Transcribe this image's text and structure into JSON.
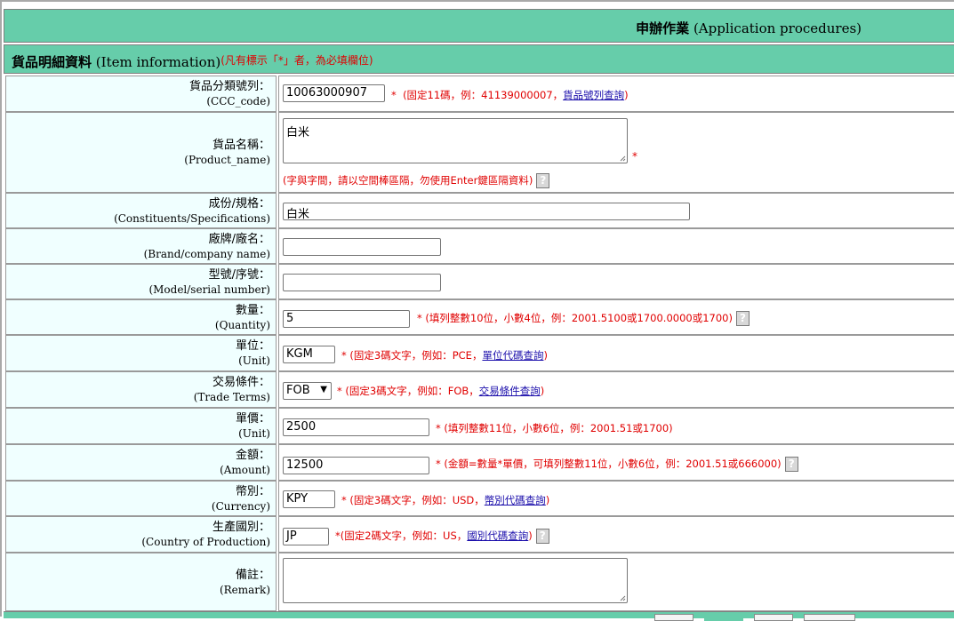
{
  "header": {
    "title_zh": "申辦作業",
    "title_en": "(Application procedures)"
  },
  "section": {
    "title_zh": "貨品明細資料",
    "title_en": "(Item information)",
    "required_note": "(凡有標示「*」者，為必填欄位)"
  },
  "fields": {
    "ccc": {
      "label_zh": "貨品分類號列：",
      "label_en": "(CCC_code)",
      "value": "10063000907",
      "star": "*",
      "note": "(固定11碼，例：41139000007，",
      "link": "貨品號列查詢",
      "note_end": ")"
    },
    "product": {
      "label_zh": "貨品名稱：",
      "label_en": "(Product_name)",
      "value": "白米",
      "star": "*",
      "note": "(字與字間，請以空間棒區隔，勿使用Enter鍵區隔資料)",
      "help": "?"
    },
    "spec": {
      "label_zh": "成份/規格：",
      "label_en": "(Constituents/Specifications)",
      "value": "白米"
    },
    "brand": {
      "label_zh": "廠牌/廠名：",
      "label_en": "(Brand/company name)",
      "value": ""
    },
    "model": {
      "label_zh": "型號/序號：",
      "label_en": "(Model/serial number)",
      "value": ""
    },
    "quantity": {
      "label_zh": "數量：",
      "label_en": "(Quantity)",
      "value": "5",
      "note": "* (填列整數10位，小數4位，例：2001.5100或1700.0000或1700)",
      "help": "?"
    },
    "unit": {
      "label_zh": "單位：",
      "label_en": "(Unit)",
      "value": "KGM",
      "note": "* (固定3碼文字，例如：PCE，",
      "link": "單位代碼查詢",
      "note_end": ")"
    },
    "trade": {
      "label_zh": "交易條件：",
      "label_en": "(Trade Terms)",
      "value": "FOB",
      "note": "* (固定3碼文字，例如：FOB，",
      "link": "交易條件查詢",
      "note_end": ")"
    },
    "price": {
      "label_zh": "單價：",
      "label_en": "(Unit)",
      "value": "2500",
      "note": "* (填列整數11位，小數6位，例：2001.51或1700)"
    },
    "amount": {
      "label_zh": "金額：",
      "label_en": "(Amount)",
      "value": "12500",
      "note": "* (金額=數量*單價，可填列整數11位，小數6位，例：2001.51或666000)",
      "help": "?"
    },
    "currency": {
      "label_zh": "幣別：",
      "label_en": "(Currency)",
      "value": "KPY",
      "note": "* (固定3碼文字，例如：USD，",
      "link": "幣別代碼查詢",
      "note_end": ")"
    },
    "country": {
      "label_zh": "生產國別：",
      "label_en": "(Country of Production)",
      "value": "JP",
      "note": "*(固定2碼文字，例如：US，",
      "link": "國別代碼查詢",
      "note_end": ")",
      "help": "?"
    },
    "remark": {
      "label_zh": "備註：",
      "label_en": "(Remark)",
      "value": ""
    }
  }
}
